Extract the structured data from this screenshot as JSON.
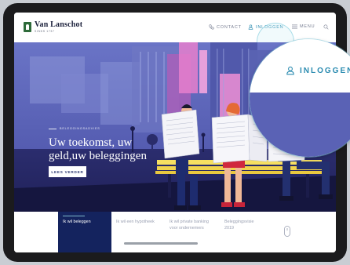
{
  "brand": {
    "name": "Van Lanschot",
    "since": "SINDS 1737",
    "color": "#2e6b3a"
  },
  "nav": {
    "contact_label": "CONTACT",
    "login_label": "INLOGGEN",
    "menu_label": "MENU"
  },
  "hero": {
    "kicker": "BELEGGINGSADVIES",
    "title_line1": "Uw toekomst, uw",
    "title_line2": "geld,uw beleggingen",
    "cta_label": "LEES VERDER"
  },
  "zoom": {
    "label": "INLOGGEN"
  },
  "tiles": [
    {
      "label": "Ik wil beleggen",
      "active": true
    },
    {
      "label": "Ik wil een hypotheek",
      "active": false
    },
    {
      "label": "Ik wil private banking voor ondernemers",
      "active": false
    },
    {
      "label": "Beleggingsvisie 2019",
      "active": false
    }
  ],
  "colors": {
    "navy": "#14235e",
    "accent": "#2a8bb0",
    "hero_sky": "#5c62b8"
  },
  "icons": {
    "contact": "phone-icon",
    "login": "user-icon",
    "menu": "hamburger-icon",
    "search": "search-icon",
    "scroll": "mouse-scroll-icon"
  }
}
